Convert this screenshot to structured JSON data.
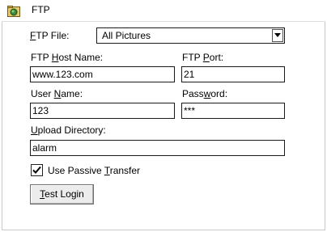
{
  "window": {
    "title": "FTP",
    "icon": "ftp-folder-icon"
  },
  "ftp_file": {
    "label_mnemonic": "F",
    "label_rest": "TP File:",
    "value": "All Pictures"
  },
  "host": {
    "label_pre": "FTP ",
    "label_mnemonic": "H",
    "label_post": "ost Name:",
    "value": "www.123.com"
  },
  "port": {
    "label_pre": "FTP ",
    "label_mnemonic": "P",
    "label_post": "ort:",
    "value": "21"
  },
  "user": {
    "label_pre": "User ",
    "label_mnemonic": "N",
    "label_post": "ame:",
    "value": "123"
  },
  "password": {
    "label_pre": "Pass",
    "label_mnemonic": "w",
    "label_post": "ord:",
    "value": "***"
  },
  "upload_dir": {
    "label_mnemonic": "U",
    "label_rest": "pload Directory:",
    "value": "alarm"
  },
  "passive": {
    "label_pre": "Use Passive ",
    "label_mnemonic": "T",
    "label_post": "ransfer",
    "checked": true
  },
  "test_login": {
    "label_mnemonic": "T",
    "label_rest": "est Login"
  }
}
